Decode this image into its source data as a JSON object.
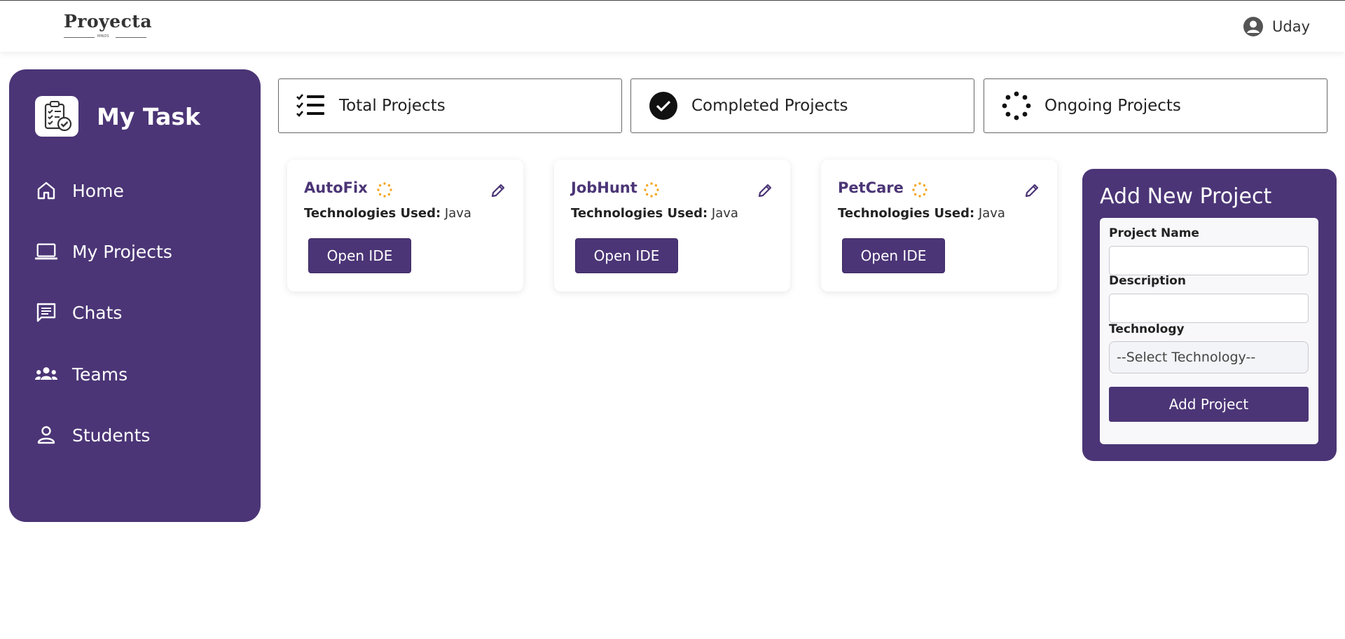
{
  "header": {
    "logo_text": "Proyecta",
    "logo_sub": "MINDS",
    "user_name": "Uday"
  },
  "sidebar": {
    "title": "My Task",
    "items": [
      {
        "label": "Home",
        "icon": "home-icon"
      },
      {
        "label": "My Projects",
        "icon": "laptop-icon"
      },
      {
        "label": "Chats",
        "icon": "chat-icon"
      },
      {
        "label": "Teams",
        "icon": "teams-icon"
      },
      {
        "label": "Students",
        "icon": "person-icon"
      }
    ]
  },
  "stats": [
    {
      "label": "Total Projects",
      "icon": "checklist-icon"
    },
    {
      "label": "Completed Projects",
      "icon": "check-circle-icon"
    },
    {
      "label": "Ongoing Projects",
      "icon": "loading-icon"
    }
  ],
  "projects": [
    {
      "name": "AutoFix",
      "tech_label": "Technologies Used:",
      "tech": "Java",
      "button": "Open IDE",
      "status_icon": "ongoing-spinner-icon"
    },
    {
      "name": "JobHunt",
      "tech_label": "Technologies Used:",
      "tech": "Java",
      "button": "Open IDE",
      "status_icon": "ongoing-spinner-icon"
    },
    {
      "name": "PetCare",
      "tech_label": "Technologies Used:",
      "tech": "Java",
      "button": "Open IDE",
      "status_icon": "ongoing-spinner-icon"
    }
  ],
  "add_project": {
    "title": "Add New Project",
    "name_label": "Project Name",
    "name_value": "",
    "description_label": "Description",
    "description_value": "",
    "technology_label": "Technology",
    "technology_selected": "--Select Technology--",
    "submit_label": "Add Project"
  },
  "colors": {
    "primary": "#4b3576",
    "spinner": "#f5a623"
  }
}
